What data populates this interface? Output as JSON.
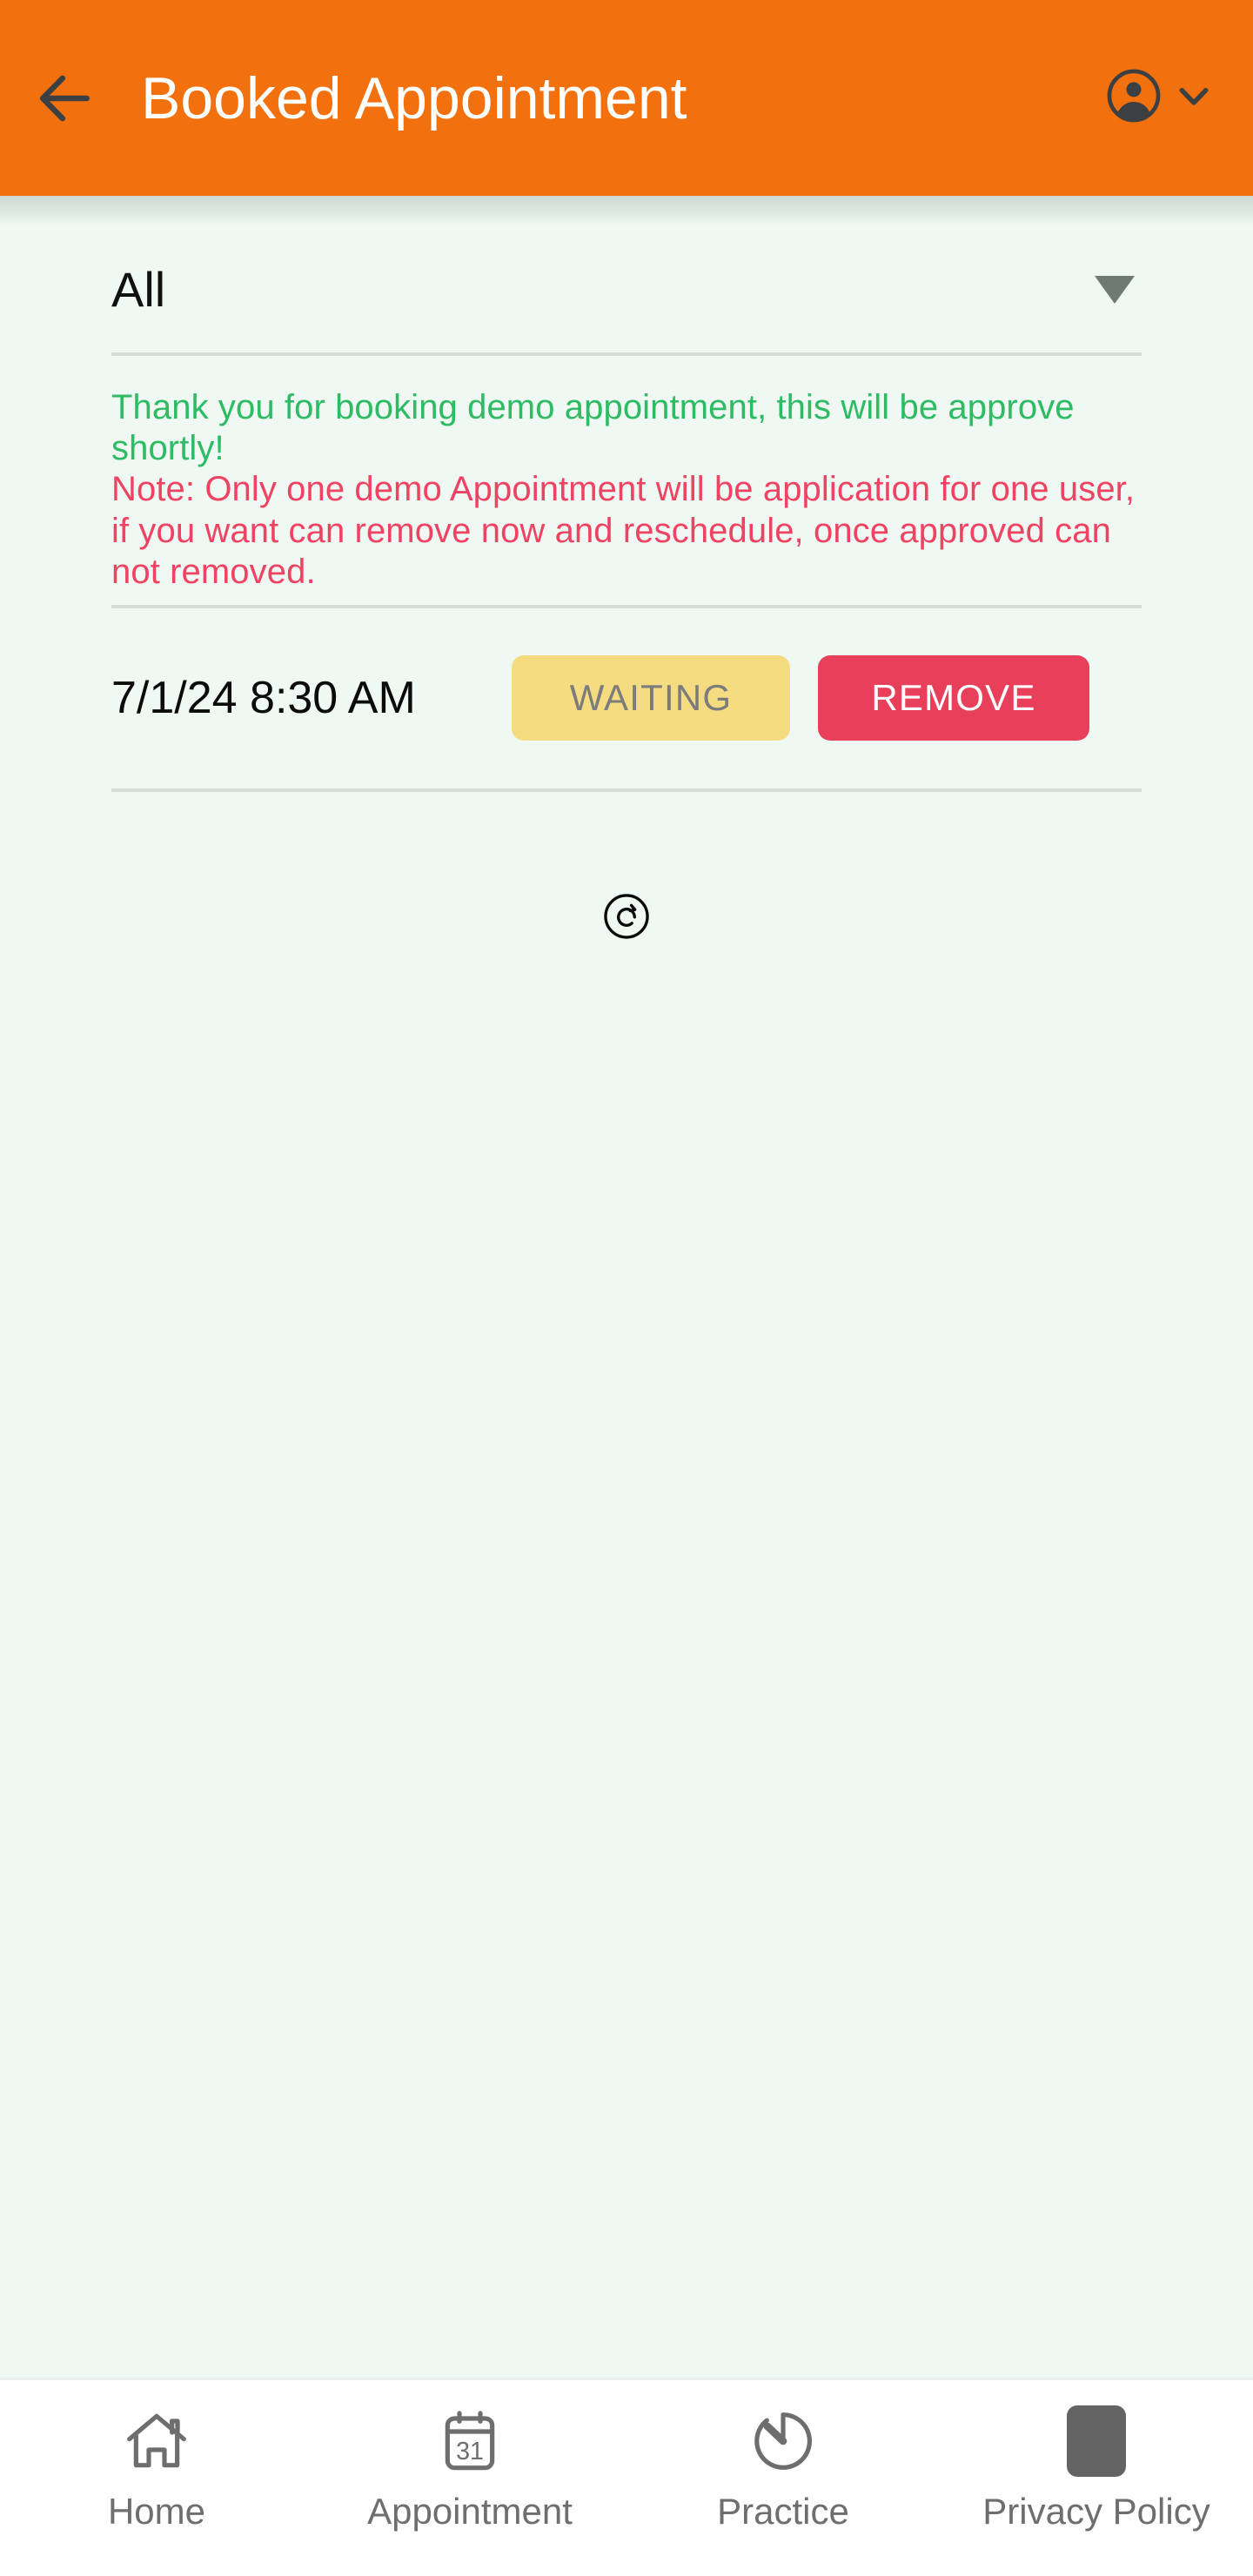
{
  "appbar": {
    "title": "Booked Appointment",
    "back_icon": "arrow-left-icon",
    "account_icon": "account-circle-icon",
    "chevron_icon": "chevron-down-icon",
    "background_color": "#F2700D",
    "title_color": "#FFFFFF"
  },
  "filter": {
    "selected": "All",
    "caret_icon": "caret-down-icon"
  },
  "messages": {
    "success": "Thank you for booking demo appointment, this will be approve shortly!",
    "success_color": "#2EBB64",
    "note": "Note: Only one demo Appointment will be application for one user, if you want can remove now and reschedule, once approved can not removed.",
    "note_color": "#EE4363"
  },
  "appointments": [
    {
      "datetime": "7/1/24 8:30 AM",
      "status_label": "WAITING",
      "status_bg": "#F5DC81",
      "status_text_color": "#7C7C7C",
      "action_label": "REMOVE",
      "action_bg": "#E8405B",
      "action_text_color": "#FFFFFF"
    }
  ],
  "refresh": {
    "icon": "refresh-circle-icon"
  },
  "bottom_nav": {
    "items": [
      {
        "label": "Home",
        "icon": "home-icon"
      },
      {
        "label": "Appointment",
        "icon": "calendar-31-icon"
      },
      {
        "label": "Practice",
        "icon": "timer-icon"
      },
      {
        "label": "Privacy Policy",
        "icon": "document-square-icon"
      }
    ],
    "label_color": "#6E6E6E"
  },
  "page_background": "#EFF8F2"
}
